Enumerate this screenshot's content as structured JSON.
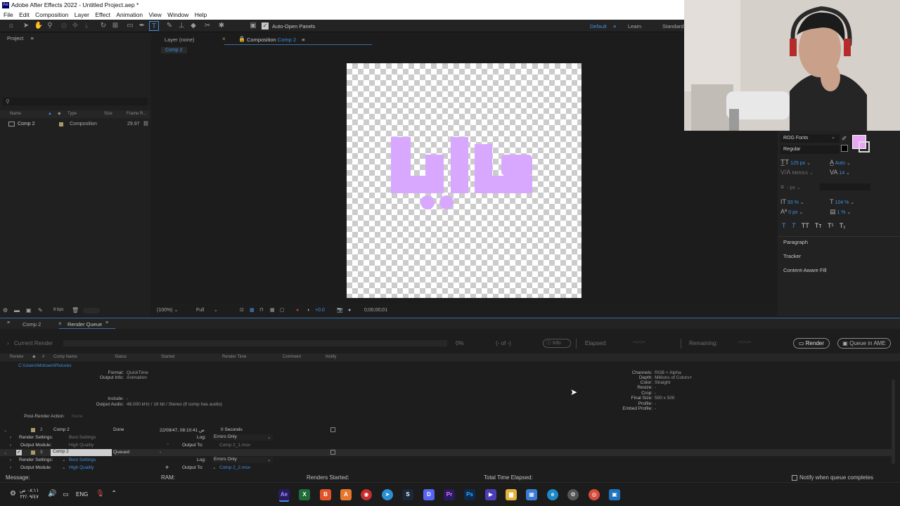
{
  "window": {
    "title": "Adobe After Effects 2022 - Untitled Project.aep *",
    "logo": "Ae"
  },
  "menu": [
    "File",
    "Edit",
    "Composition",
    "Layer",
    "Effect",
    "Animation",
    "View",
    "Window",
    "Help"
  ],
  "toolbar": {
    "auto_open_label": "Auto-Open Panels",
    "workspaces": [
      "Default",
      "Learn",
      "Standard"
    ]
  },
  "project": {
    "header": "Project",
    "columns": [
      "Name",
      "Type",
      "Size",
      "Frame R..."
    ],
    "items": [
      {
        "name": "Comp 2",
        "type": "Composition",
        "frame_rate": "29.97"
      }
    ],
    "bpc": "8 bpc"
  },
  "composition": {
    "layer_tab": "Layer (none)",
    "comp_tab_prefix": "Composition",
    "comp_tab_name": "Comp 2",
    "breadcrumb": "Comp 2",
    "artwork_text": "دايا",
    "artwork_color": "#d8a8ff",
    "zoom": "(100%)",
    "resolution": "Full",
    "exposure": "+0.0",
    "timecode": "0;00;00;01"
  },
  "character": {
    "font": "ROG Fonts",
    "style": "Regular",
    "size": "125 px",
    "leading": "Auto",
    "kerning": "Metrics",
    "tracking": "14",
    "stroke_unit": "- px",
    "vscale": "93 %",
    "hscale": "104 %",
    "baseline": "0 px",
    "tsume": "1 %",
    "fill_color": "#e8a6f5",
    "style_buttons": [
      "T",
      "T",
      "TT",
      "Tт",
      "T¹",
      "T₁"
    ],
    "sections": [
      "Paragraph",
      "Tracker",
      "Content-Aware Fill"
    ]
  },
  "render_queue": {
    "tabs": [
      "Comp 2",
      "Render Queue"
    ],
    "current_render": "Current Render",
    "percent": "0%",
    "of": "(- of -)",
    "info": "Info",
    "elapsed": "Elapsed:",
    "elapsed_val": "--:--:--",
    "remaining": "Remaining:",
    "remaining_val": "--:--:--",
    "render_btn": "Render",
    "queue_ame_btn": "Queue in AME",
    "columns": [
      "Render",
      "#",
      "Comp Name",
      "Status",
      "Started",
      "Render Time",
      "Comment",
      "Notify"
    ],
    "path": "C:\\Users\\Mohsen\\Pictures",
    "details": {
      "format_label": "Format:",
      "format": "QuickTime",
      "output_info_label": "Output Info:",
      "output_info": "Animation",
      "include_label": "Include:",
      "include": "-",
      "output_audio_label": "Output Audio:",
      "output_audio": "48.000 kHz / 16 bit / Stereo (if comp has audio)",
      "channels_label": "Channels:",
      "channels": "RGB + Alpha",
      "depth_label": "Depth:",
      "depth": "Millions of Colors+",
      "color_label": "Color:",
      "color": "Straight",
      "resize_label": "Resize:",
      "resize": "-",
      "crop_label": "Crop:",
      "crop": "-",
      "final_size_label": "Final Size:",
      "final_size": "500 x 500",
      "profile_label": "Profile:",
      "profile": "-",
      "embed_label": "Embed Profile:",
      "embed": "-"
    },
    "post_render_label": "Post-Render Action:",
    "post_render": "None",
    "items": [
      {
        "num": "2",
        "name": "Comp 2",
        "status": "Done",
        "started": "22/09/47, 08:10:41 ص",
        "render_time": "0 Seconds",
        "render_settings": "Best Settings",
        "output_module": "High Quality",
        "log": "Errors Only",
        "output_to": "Comp 2_1.mov"
      },
      {
        "num": "3",
        "name": "Comp 2",
        "status": "Queued",
        "started": "-",
        "render_time": "",
        "render_settings": "Best Settings",
        "output_module": "High Quality",
        "log": "Errors Only",
        "output_to": "Comp 2_2.mov"
      }
    ],
    "labels": {
      "render_settings": "Render Settings:",
      "output_module": "Output Module:",
      "log": "Log:",
      "output_to": "Output To:"
    }
  },
  "status": {
    "message": "Message:",
    "ram": "RAM:",
    "renders_started": "Renders Started:",
    "total_elapsed": "Total Time Elapsed:",
    "notify": "Notify when queue completes"
  },
  "taskbar": {
    "time": "٠٨:١١ ص",
    "date": "٢٢/٠٩/٤٧",
    "lang": "ENG",
    "apps": [
      {
        "label": "Ae",
        "color": "#2a1a5e"
      },
      {
        "label": "X",
        "color": "#1f6b3a"
      },
      {
        "label": "B",
        "color": "#e0542a"
      },
      {
        "label": "A",
        "color": "#e8762d"
      },
      {
        "label": "◉",
        "color": "#c62d2d"
      },
      {
        "label": "➤",
        "color": "#2a8fd6"
      },
      {
        "label": "S",
        "color": "#1b2838"
      },
      {
        "label": "D",
        "color": "#5865f2"
      },
      {
        "label": "Pr",
        "color": "#2a1a5e"
      },
      {
        "label": "Ps",
        "color": "#0d2a4a"
      },
      {
        "label": "▶",
        "color": "#4b3fb5"
      },
      {
        "label": "▆",
        "color": "#e3b23c"
      },
      {
        "label": "▦",
        "color": "#3a7bd5"
      },
      {
        "label": "e",
        "color": "#1e88c7"
      },
      {
        "label": "⚙",
        "color": "#555555"
      },
      {
        "label": "◎",
        "color": "#d64b3a"
      },
      {
        "label": "▣",
        "color": "#1e73be"
      }
    ]
  }
}
